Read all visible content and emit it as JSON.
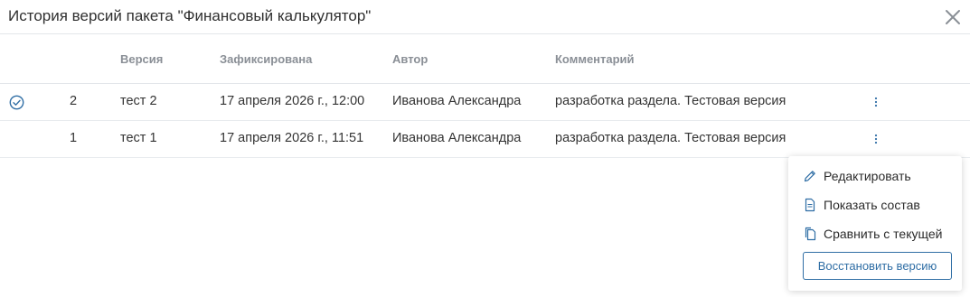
{
  "dialog": {
    "title": "История версий пакета \"Финансовый калькулятор\""
  },
  "table": {
    "columns": {
      "version": "Версия",
      "committed": "Зафиксирована",
      "author": "Автор",
      "comment": "Комментарий"
    },
    "rows": [
      {
        "number": "2",
        "version": "тест 2",
        "committed": "17 апреля 2026 г., 12:00",
        "author": "Иванова Александра",
        "comment": "разработка раздела. Тестовая версия",
        "current": true
      },
      {
        "number": "1",
        "version": "тест 1",
        "committed": "17 апреля 2026 г., 11:51",
        "author": "Иванова Александра",
        "comment": "разработка раздела. Тестовая версия",
        "current": false
      }
    ]
  },
  "context_menu": {
    "items": [
      {
        "label": "Редактировать",
        "icon": "pencil-icon"
      },
      {
        "label": "Показать состав",
        "icon": "document-icon"
      },
      {
        "label": "Сравнить с текущей",
        "icon": "copy-icon"
      }
    ],
    "restore_label": "Восстановить версию"
  },
  "colors": {
    "accent": "#2f6ea5",
    "header_text": "#8a8f96",
    "divider": "#e3e6ea"
  }
}
